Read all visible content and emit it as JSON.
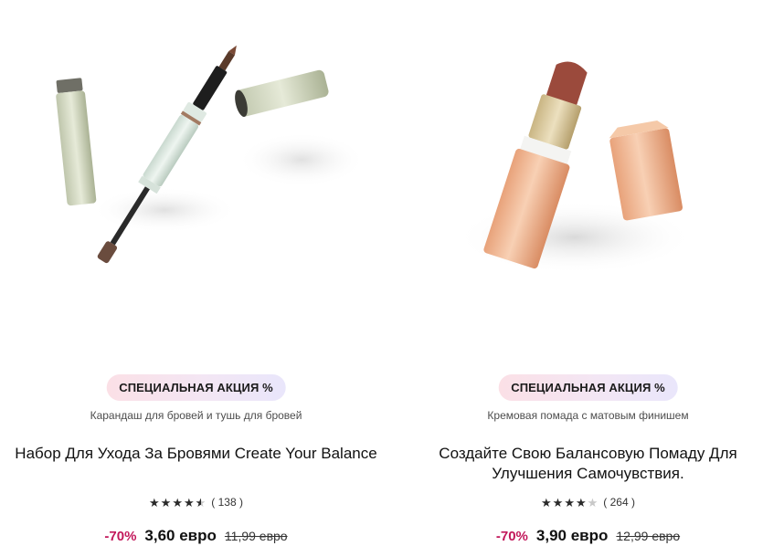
{
  "products": [
    {
      "image_alt": "brow-pencil-and-mascara",
      "badge": "СПЕЦИАЛЬНАЯ АКЦИЯ %",
      "subtitle": "Карандаш для бровей и тушь для бровей",
      "title": "Набор Для Ухода За Бровями Create Your Balance",
      "rating_stars": 4.5,
      "rating_count": "( 138 )",
      "discount": "-70%",
      "price": "3,60 евро",
      "old_price": "11,99 евро"
    },
    {
      "image_alt": "lipstick",
      "badge": "СПЕЦИАЛЬНАЯ АКЦИЯ %",
      "subtitle": "Кремовая помада с матовым финишем",
      "title": "Создайте Свою Балансовую Помаду Для Улучшения Самочувствия.",
      "rating_stars": 4,
      "rating_count": "( 264 )",
      "discount": "-70%",
      "price": "3,90 евро",
      "old_price": "12,99 евро"
    }
  ],
  "colors": {
    "discount": "#c2185b",
    "badge_gradient_start": "#fbe0e6",
    "badge_gradient_end": "#e9e6fb"
  }
}
